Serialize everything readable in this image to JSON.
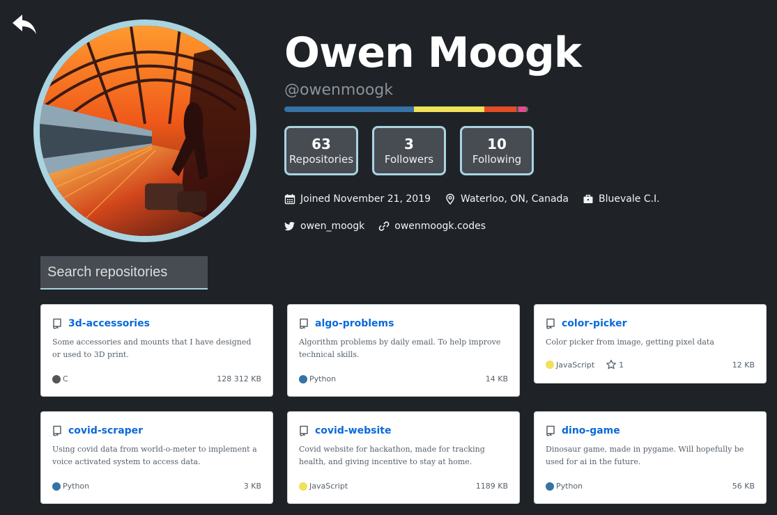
{
  "profile": {
    "name": "Owen Moogk",
    "handle": "@owenmoogk",
    "stats": [
      {
        "count": "63",
        "label": "Repositories"
      },
      {
        "count": "3",
        "label": "Followers"
      },
      {
        "count": "10",
        "label": "Following"
      }
    ],
    "joined": "Joined November 21, 2019",
    "location": "Waterloo, ON, Canada",
    "company": "Bluevale C.I.",
    "twitter": "owen_moogk",
    "website": "owenmoogk.codes",
    "language_bar": [
      {
        "color": "#3572a5",
        "fraction": 0.53
      },
      {
        "color": "#f1e05a",
        "fraction": 0.29
      },
      {
        "color": "#e34c26",
        "fraction": 0.13
      },
      {
        "color": "#555555",
        "fraction": 0.01
      },
      {
        "color": "#e44b8d",
        "fraction": 0.03
      },
      {
        "color": "#6e6e6e",
        "fraction": 0.01
      }
    ]
  },
  "search": {
    "placeholder": "Search repositories"
  },
  "repos": [
    {
      "name": "3d-accessories",
      "description": "Some accessories and mounts that I have designed or used to 3D print.",
      "language": "C",
      "lang_color": "#555555",
      "size": "128 312 KB"
    },
    {
      "name": "algo-problems",
      "description": "Algorithm problems by daily email. To help improve technical skills.",
      "language": "Python",
      "lang_color": "#3572a5",
      "size": "14 KB"
    },
    {
      "name": "color-picker",
      "description": "Color picker from image, getting pixel data",
      "language": "JavaScript",
      "lang_color": "#f1e05a",
      "stars": "1",
      "size": "12 KB"
    },
    {
      "name": "covid-scraper",
      "description": "Using covid data from world-o-meter to implement a voice activated system to access data.",
      "language": "Python",
      "lang_color": "#3572a5",
      "size": "3 KB"
    },
    {
      "name": "covid-website",
      "description": "Covid website for hackathon, made for tracking health, and giving incentive to stay at home.",
      "language": "JavaScript",
      "lang_color": "#f1e05a",
      "size": "1189 KB"
    },
    {
      "name": "dino-game",
      "description": "Dinosaur game, made in pygame. Will hopefully be used for ai in the future.",
      "language": "Python",
      "lang_color": "#3572a5",
      "size": "56 KB"
    }
  ]
}
